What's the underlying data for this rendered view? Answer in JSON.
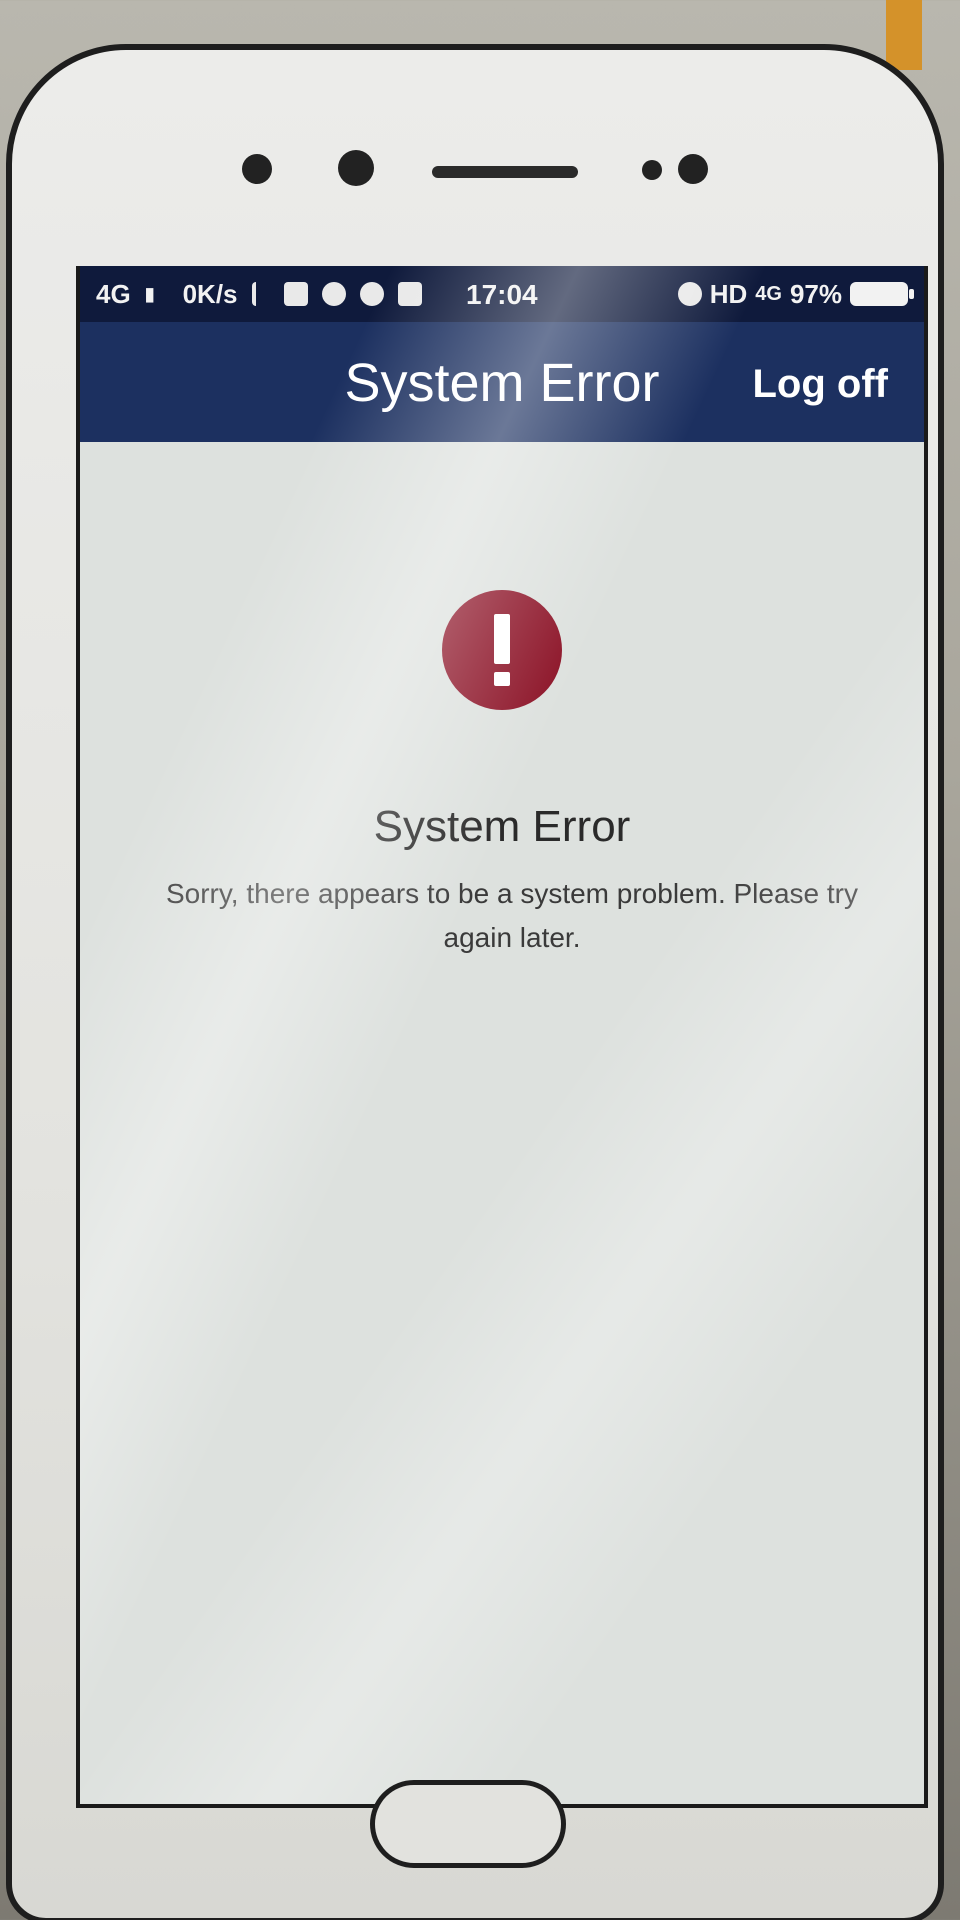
{
  "status_bar": {
    "network": "4G",
    "speed": "0K/s",
    "time": "17:04",
    "hd": "HD",
    "network_right": "4G",
    "battery": "97%"
  },
  "app_bar": {
    "title": "System Error",
    "logoff_label": "Log off"
  },
  "error": {
    "icon": "exclamation-circle-icon",
    "title": "System Error",
    "message": "Sorry, there appears to be a system problem. Please try again later."
  },
  "colors": {
    "app_bar": "#1c3060",
    "status_bar": "#0f1a3c",
    "alert": "#8c1327",
    "content_bg": "#dde1de"
  }
}
